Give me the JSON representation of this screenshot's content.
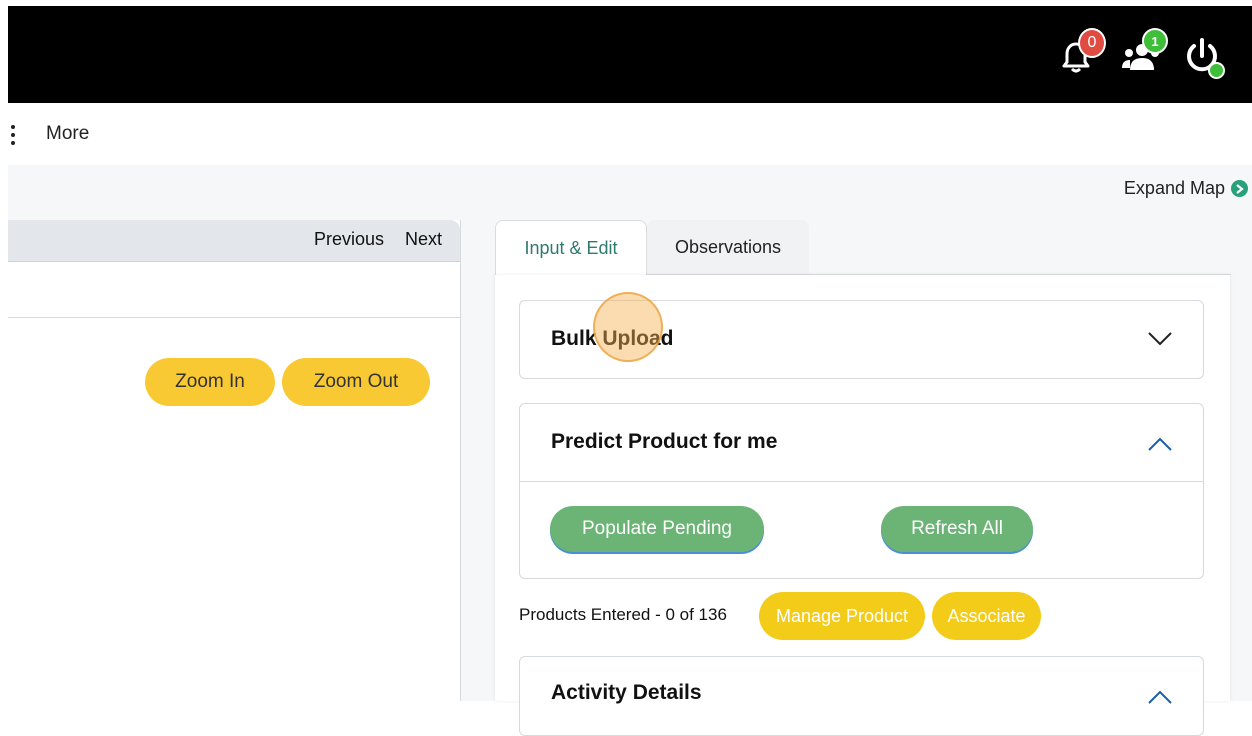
{
  "header": {
    "notifications_count": "0",
    "users_count": "1",
    "colors": {
      "bar": "#000000",
      "notif_badge": "#e04b42",
      "user_badge": "#3fbe3a",
      "status_dot": "#3fbe3a"
    }
  },
  "nav": {
    "more_label": "More"
  },
  "map": {
    "expand_label": "Expand Map"
  },
  "left_panel": {
    "previous_label": "Previous",
    "next_label": "Next",
    "zoom_in_label": "Zoom In",
    "zoom_out_label": "Zoom Out"
  },
  "tabs": [
    {
      "label": "Input & Edit",
      "active": true
    },
    {
      "label": "Observations",
      "active": false
    }
  ],
  "cards": {
    "bulk_upload": {
      "title": "Bulk Upload",
      "expanded": false
    },
    "predict": {
      "title": "Predict Product for me",
      "expanded": true,
      "populate_label": "Populate Pending",
      "refresh_label": "Refresh All"
    },
    "activity": {
      "title": "Activity Details",
      "expanded": true
    }
  },
  "products": {
    "entered_text": "Products Entered - 0 of 136",
    "manage_label": "Manage Product",
    "associate_label": "Associate"
  },
  "icons": [
    "bell-icon",
    "users-icon",
    "power-icon",
    "kebab-icon",
    "chevron-right-circle-icon",
    "chevron-down-icon",
    "chevron-up-icon"
  ]
}
